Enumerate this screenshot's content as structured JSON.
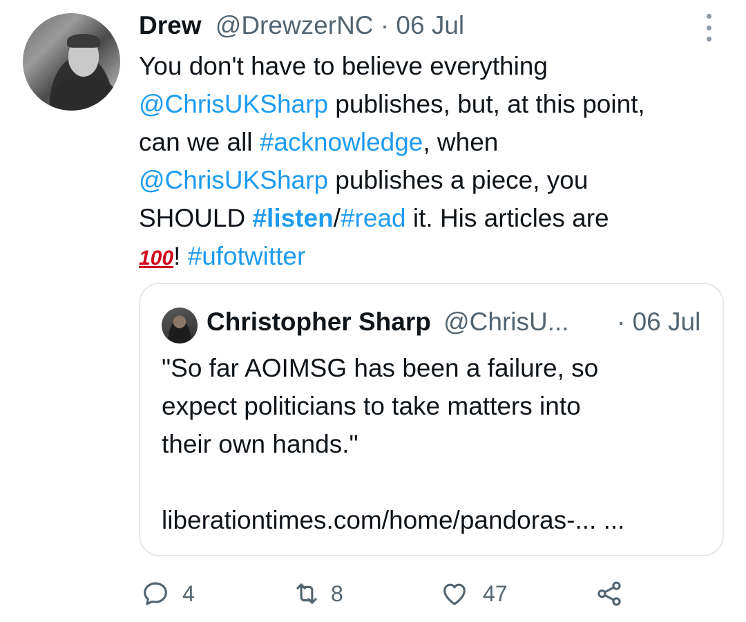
{
  "tweet": {
    "author_name": "Drew",
    "author_handle": "@DrewzerNC",
    "separator": " · ",
    "date": "06 Jul",
    "text_lines": [
      [
        "You don't have to believe everything"
      ],
      [
        "@ChrisUKSharp",
        " publishes, but, at this point,"
      ],
      [
        "can we all ",
        "#acknowledge",
        ", when"
      ],
      [
        "@ChrisUKSharp",
        " publishes a piece, you"
      ],
      [
        "SHOULD ",
        "#listen",
        "/",
        "#read",
        " it. His articles are"
      ],
      [
        "100",
        "! ",
        "#ufotwitter"
      ]
    ]
  },
  "quoted": {
    "author_name": "Christopher Sharp",
    "author_handle": "@ChrisU...",
    "separator": " · ",
    "date": "06 Jul",
    "text_lines": [
      "\"So far AOIMSG has been a failure, so",
      "expect politicians to take matters into",
      "their own hands.\"",
      "",
      "liberationtimes.com/home/pandoras-... ..."
    ]
  },
  "actions": {
    "reply_count": "4",
    "retweet_count": "8",
    "like_count": "47"
  },
  "colors": {
    "link": "#1d9bf0",
    "text": "#0f1419",
    "muted": "#536471",
    "border": "#e3e8ec"
  },
  "icons": [
    "reply-icon",
    "retweet-icon",
    "like-icon",
    "share-icon",
    "more-options-icon",
    "hundred-points-emoji"
  ]
}
